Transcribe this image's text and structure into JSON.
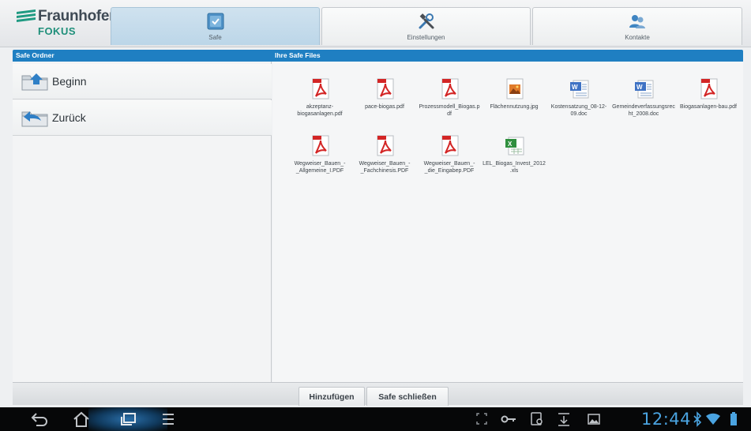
{
  "brand": {
    "name": "Fraunhofer",
    "sub": "FOKUS"
  },
  "tabs": [
    {
      "label": "Safe",
      "icon": "safe-icon",
      "active": true
    },
    {
      "label": "Einstellungen",
      "icon": "tools-icon",
      "active": false
    },
    {
      "label": "Kontakte",
      "icon": "contacts-icon",
      "active": false
    }
  ],
  "left_header": "Safe Ordner",
  "right_header": "Ihre Safe Files",
  "nav": [
    {
      "label": "Beginn",
      "icon": "home-folder-icon"
    },
    {
      "label": "Zurück",
      "icon": "back-folder-icon"
    }
  ],
  "files": [
    {
      "name": "akzeptanz-biogasanlagen.pdf",
      "icon": "pdf-icon"
    },
    {
      "name": "pace-biogas.pdf",
      "icon": "pdf-icon"
    },
    {
      "name": "Prozessmodell_Biogas.pdf",
      "icon": "pdf-icon"
    },
    {
      "name": "Flächennutzung.jpg",
      "icon": "image-icon"
    },
    {
      "name": "Kostensatzung_08-12-09.doc",
      "icon": "doc-icon"
    },
    {
      "name": "Gemeindeverfassungsrecht_2008.doc",
      "icon": "doc-icon"
    },
    {
      "name": "Biogasanlagen-bau.pdf",
      "icon": "pdf-icon"
    },
    {
      "name": "Wegweiser_Bauen_-_Allgemeine_I.PDF",
      "icon": "pdf-icon"
    },
    {
      "name": "Wegweiser_Bauen_-_Fachchinesis.PDF",
      "icon": "pdf-icon"
    },
    {
      "name": "Wegweiser_Bauen_-_die_Eingabep.PDF",
      "icon": "pdf-icon"
    },
    {
      "name": "LEL_Biogas_Invest_2012.xls",
      "icon": "xls-icon"
    }
  ],
  "actions": {
    "add": "Hinzufügen",
    "close": "Safe schließen"
  },
  "system": {
    "time": "12:44"
  },
  "colors": {
    "header": "#1f7fc2",
    "accent": "#1f8f7a",
    "clock": "#4aa3e0"
  }
}
